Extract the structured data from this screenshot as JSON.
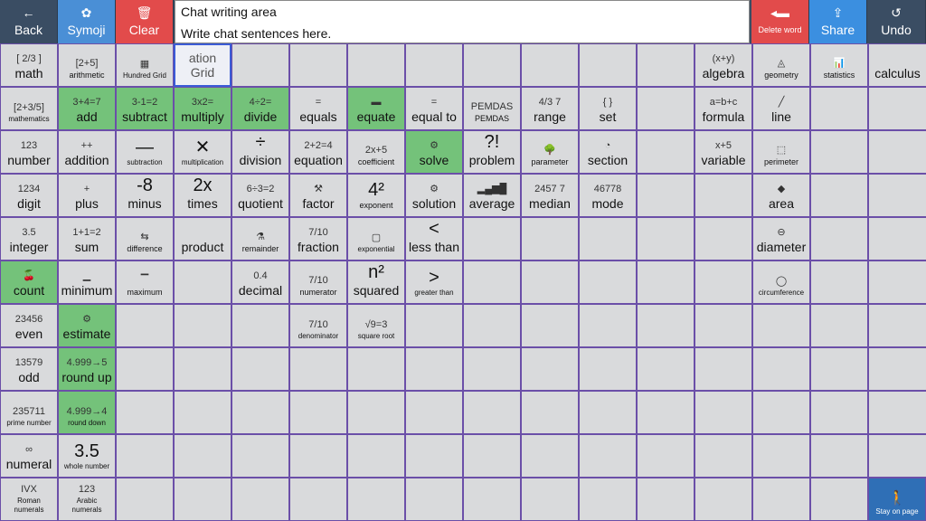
{
  "toolbar": {
    "back": {
      "label": "Back",
      "icon": "←"
    },
    "symoji": {
      "label": "Symoji",
      "icon": "✿"
    },
    "clear": {
      "label": "Clear",
      "icon": "🗑"
    },
    "delete_word": {
      "label": "Delete word",
      "icon": "◂▬"
    },
    "share": {
      "label": "Share",
      "icon": "⇪"
    },
    "undo": {
      "label": "Undo",
      "icon": "↺"
    }
  },
  "chat": {
    "title": "Chat writing area",
    "placeholder": "Write chat sentences here."
  },
  "colors": {
    "toolbar": "#3a4d63",
    "back": "#3a4d63",
    "symoji": "#4a8fd6",
    "clear": "#e24b4b",
    "delete": "#e24b4b",
    "share": "#3b8fe0",
    "undo": "#3a4d63",
    "green": "#74c27a",
    "cell": "#d9dadc",
    "grid_border": "#6b4fa8",
    "stay": "#2f6fb6"
  },
  "cells": [
    {
      "r": 0,
      "c": 0,
      "label": "math",
      "sym": "[ 2/3 ]"
    },
    {
      "r": 0,
      "c": 1,
      "label": "arithmetic",
      "sym": "[2+5]",
      "small": true
    },
    {
      "r": 0,
      "c": 2,
      "label": "Hundred Grid",
      "sym": "▦",
      "xs": true
    },
    {
      "r": 0,
      "c": 3,
      "label": "ation\nGrid",
      "sym": "",
      "sel": true
    },
    {
      "r": 0,
      "c": 12,
      "label": "algebra",
      "sym": "(x+y)"
    },
    {
      "r": 0,
      "c": 13,
      "label": "geometry",
      "sym": "◬",
      "small": true
    },
    {
      "r": 0,
      "c": 14,
      "label": "statistics",
      "sym": "📊",
      "small": true
    },
    {
      "r": 0,
      "c": 15,
      "label": "calculus",
      "sym": ""
    },
    {
      "r": 1,
      "c": 0,
      "label": "mathematics",
      "sym": "[2+3/5]",
      "xs": true
    },
    {
      "r": 1,
      "c": 1,
      "label": "add",
      "sym": "3+4=7",
      "green": true
    },
    {
      "r": 1,
      "c": 2,
      "label": "subtract",
      "sym": "3-1=2",
      "green": true
    },
    {
      "r": 1,
      "c": 3,
      "label": "multiply",
      "sym": "3x2=",
      "green": true
    },
    {
      "r": 1,
      "c": 4,
      "label": "divide",
      "sym": "4÷2=",
      "green": true
    },
    {
      "r": 1,
      "c": 5,
      "label": "equals",
      "sym": "="
    },
    {
      "r": 1,
      "c": 6,
      "label": "equate",
      "sym": "▬",
      "green": true
    },
    {
      "r": 1,
      "c": 7,
      "label": "equal to",
      "sym": "="
    },
    {
      "r": 1,
      "c": 8,
      "label": "PEMDAS",
      "sym": "PEMDAS",
      "small": true
    },
    {
      "r": 1,
      "c": 9,
      "label": "range",
      "sym": "4/3 7"
    },
    {
      "r": 1,
      "c": 10,
      "label": "set",
      "sym": "{ }"
    },
    {
      "r": 1,
      "c": 12,
      "label": "formula",
      "sym": "a=b+c"
    },
    {
      "r": 1,
      "c": 13,
      "label": "line",
      "sym": "╱"
    },
    {
      "r": 2,
      "c": 0,
      "label": "number",
      "sym": "123"
    },
    {
      "r": 2,
      "c": 1,
      "label": "addition",
      "sym": "++"
    },
    {
      "r": 2,
      "c": 2,
      "label": "subtraction",
      "sym": "—",
      "big": true,
      "xs": true
    },
    {
      "r": 2,
      "c": 3,
      "label": "multiplication",
      "sym": "✕",
      "big": true,
      "xs": true
    },
    {
      "r": 2,
      "c": 4,
      "label": "division",
      "sym": "÷",
      "big": true
    },
    {
      "r": 2,
      "c": 5,
      "label": "equation",
      "sym": "2+2=4"
    },
    {
      "r": 2,
      "c": 6,
      "label": "coefficient",
      "sym": "2x+5",
      "small": true
    },
    {
      "r": 2,
      "c": 7,
      "label": "solve",
      "sym": "⚙",
      "green": true
    },
    {
      "r": 2,
      "c": 8,
      "label": "problem",
      "sym": "?!",
      "big": true
    },
    {
      "r": 2,
      "c": 9,
      "label": "parameter",
      "sym": "🌳",
      "small": true
    },
    {
      "r": 2,
      "c": 10,
      "label": "section",
      "sym": "◔"
    },
    {
      "r": 2,
      "c": 12,
      "label": "variable",
      "sym": "x+5"
    },
    {
      "r": 2,
      "c": 13,
      "label": "perimeter",
      "sym": "⬚",
      "small": true
    },
    {
      "r": 3,
      "c": 0,
      "label": "digit",
      "sym": "1234"
    },
    {
      "r": 3,
      "c": 1,
      "label": "plus",
      "sym": "+"
    },
    {
      "r": 3,
      "c": 2,
      "label": "minus",
      "sym": "-8",
      "big": true
    },
    {
      "r": 3,
      "c": 3,
      "label": "times",
      "sym": "2x",
      "big": true
    },
    {
      "r": 3,
      "c": 4,
      "label": "quotient",
      "sym": "6÷3=2"
    },
    {
      "r": 3,
      "c": 5,
      "label": "factor",
      "sym": "⚒"
    },
    {
      "r": 3,
      "c": 6,
      "label": "exponent",
      "sym": "4²",
      "big": true,
      "small": true
    },
    {
      "r": 3,
      "c": 7,
      "label": "solution",
      "sym": "⚙"
    },
    {
      "r": 3,
      "c": 8,
      "label": "average",
      "sym": "▂▄▆█"
    },
    {
      "r": 3,
      "c": 9,
      "label": "median",
      "sym": "2457 7"
    },
    {
      "r": 3,
      "c": 10,
      "label": "mode",
      "sym": "46778"
    },
    {
      "r": 3,
      "c": 13,
      "label": "area",
      "sym": "◆"
    },
    {
      "r": 4,
      "c": 0,
      "label": "integer",
      "sym": "3.5"
    },
    {
      "r": 4,
      "c": 1,
      "label": "sum",
      "sym": "1+1=2"
    },
    {
      "r": 4,
      "c": 2,
      "label": "difference",
      "sym": "⇆",
      "small": true
    },
    {
      "r": 4,
      "c": 3,
      "label": "product",
      "sym": ""
    },
    {
      "r": 4,
      "c": 4,
      "label": "remainder",
      "sym": "⚗",
      "small": true
    },
    {
      "r": 4,
      "c": 5,
      "label": "fraction",
      "sym": "7/10"
    },
    {
      "r": 4,
      "c": 6,
      "label": "exponential",
      "sym": "▢",
      "xs": true
    },
    {
      "r": 4,
      "c": 7,
      "label": "less than",
      "sym": "<",
      "big": true
    },
    {
      "r": 4,
      "c": 13,
      "label": "diameter",
      "sym": "⊖"
    },
    {
      "r": 5,
      "c": 0,
      "label": "count",
      "sym": "🍒",
      "green": true
    },
    {
      "r": 5,
      "c": 1,
      "label": "minimum",
      "sym": "▁"
    },
    {
      "r": 5,
      "c": 2,
      "label": "maximum",
      "sym": "▔",
      "small": true
    },
    {
      "r": 5,
      "c": 4,
      "label": "decimal",
      "sym": "0.4"
    },
    {
      "r": 5,
      "c": 5,
      "label": "numerator",
      "sym": "7/10",
      "small": true
    },
    {
      "r": 5,
      "c": 6,
      "label": "squared",
      "sym": "n²",
      "big": true
    },
    {
      "r": 5,
      "c": 7,
      "label": "greater than",
      "sym": ">",
      "big": true,
      "xs": true
    },
    {
      "r": 5,
      "c": 13,
      "label": "circumference",
      "sym": "◯",
      "xs": true
    },
    {
      "r": 6,
      "c": 0,
      "label": "even",
      "sym": "23456"
    },
    {
      "r": 6,
      "c": 1,
      "label": "estimate",
      "sym": "⚙",
      "green": true
    },
    {
      "r": 6,
      "c": 5,
      "label": "denominator",
      "sym": "7/10",
      "xs": true
    },
    {
      "r": 6,
      "c": 6,
      "label": "square root",
      "sym": "√9=3",
      "xs": true
    },
    {
      "r": 7,
      "c": 0,
      "label": "odd",
      "sym": "13579"
    },
    {
      "r": 7,
      "c": 1,
      "label": "round up",
      "sym": "4.999→5",
      "green": true
    },
    {
      "r": 8,
      "c": 0,
      "label": "prime number",
      "sym": "235711",
      "xs": true
    },
    {
      "r": 8,
      "c": 1,
      "label": "round down",
      "sym": "4.999→4",
      "green": true,
      "xs": true
    },
    {
      "r": 9,
      "c": 0,
      "label": "numeral",
      "sym": "∞"
    },
    {
      "r": 9,
      "c": 1,
      "label": "whole number",
      "sym": "3.5",
      "big": true,
      "xs": true
    },
    {
      "r": 10,
      "c": 0,
      "label": "Roman\nnumerals",
      "sym": "IVX",
      "xs": true
    },
    {
      "r": 10,
      "c": 1,
      "label": "Arabic\nnumerals",
      "sym": "123",
      "xs": true
    }
  ],
  "stay_on_page": {
    "label": "Stay on page",
    "icon": "🚶"
  }
}
